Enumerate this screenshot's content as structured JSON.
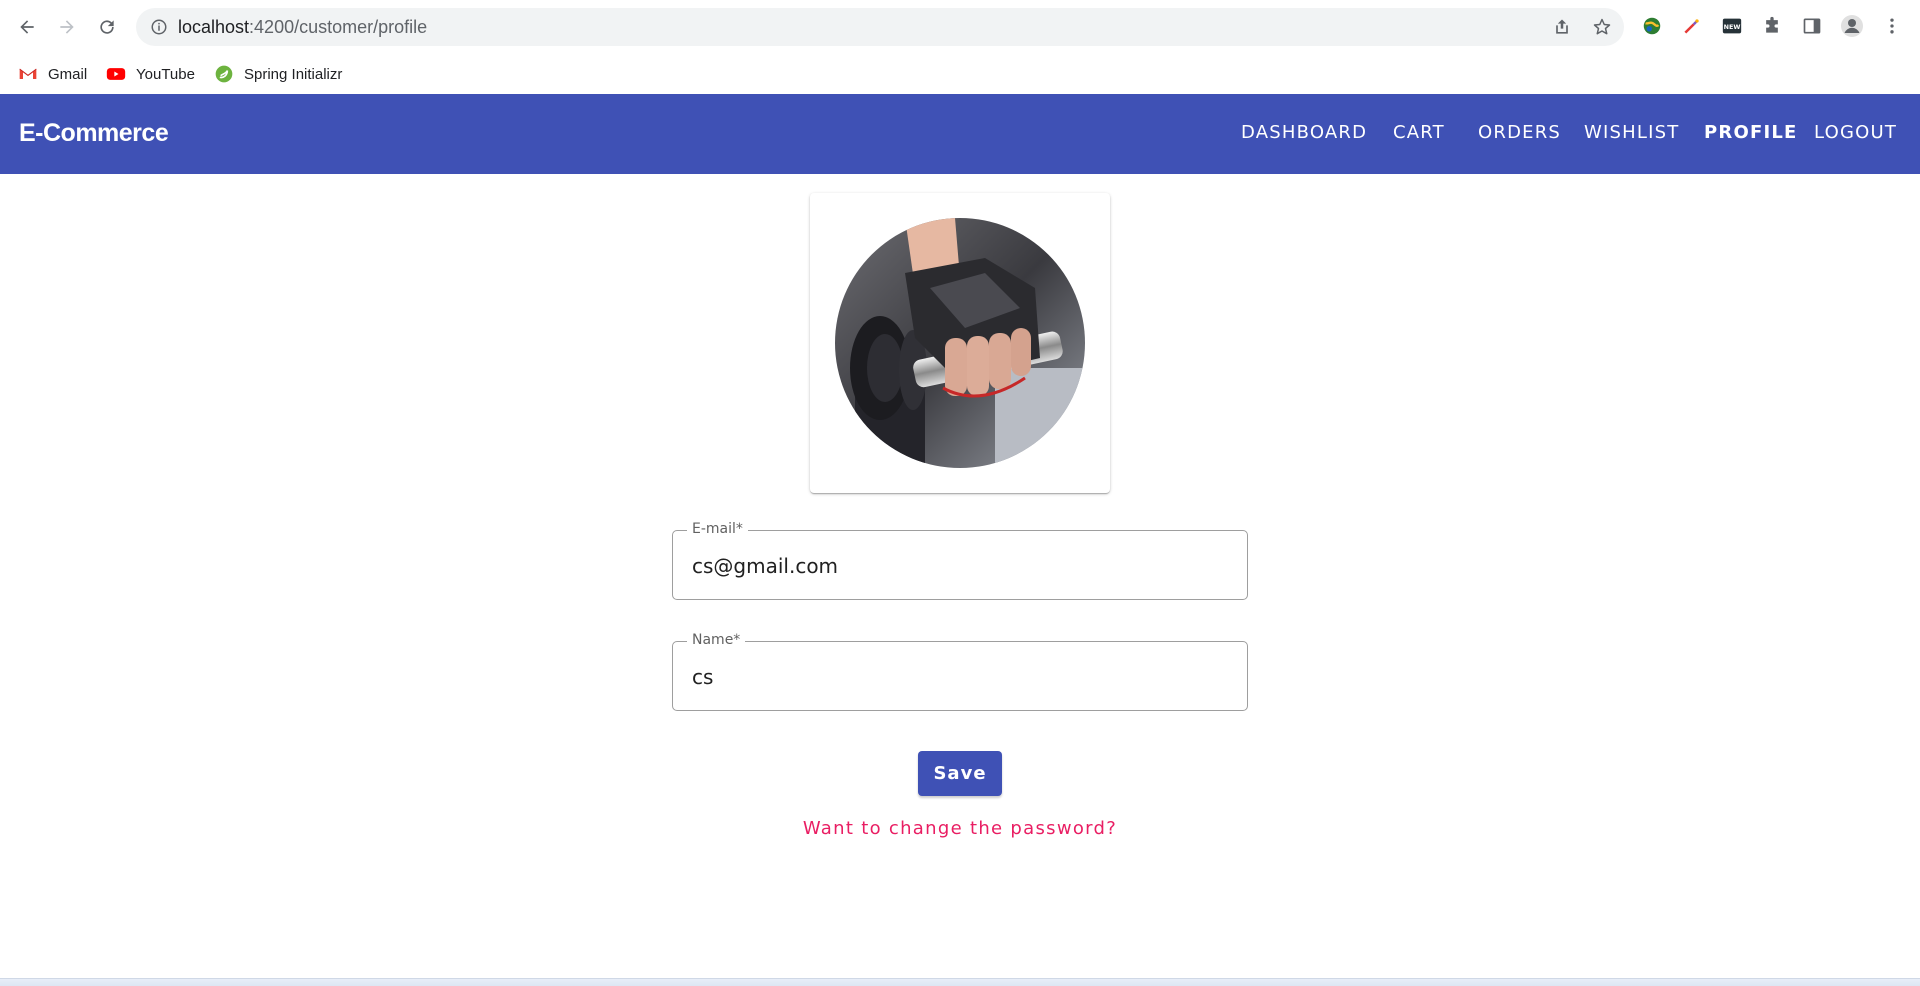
{
  "browser": {
    "url_host": "localhost",
    "url_path": ":4200/customer/profile",
    "bookmarks": [
      {
        "label": "Gmail",
        "icon": "gmail-icon"
      },
      {
        "label": "YouTube",
        "icon": "youtube-icon"
      },
      {
        "label": "Spring Initializr",
        "icon": "spring-icon"
      }
    ]
  },
  "toolbar": {
    "brand": "E-Commerce",
    "nav": [
      "DASHBOARD",
      "CART",
      "ORDERS",
      "WISHLIST",
      "PROFILE",
      "LOGOUT"
    ],
    "active": "PROFILE",
    "color": "#3f51b5"
  },
  "profile": {
    "avatar_image": "hand-gripping-dumbbell-photo",
    "email": {
      "label": "E-mail*",
      "value": "cs@gmail.com"
    },
    "name": {
      "label": "Name*",
      "value": "cs"
    },
    "save_label": "Save",
    "change_password_link": "Want to change the password?",
    "link_color": "#e91e63"
  }
}
